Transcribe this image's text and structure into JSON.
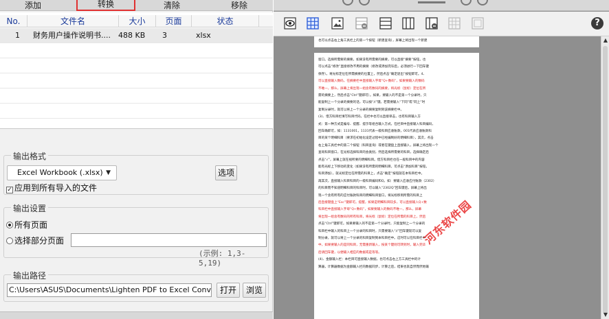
{
  "toolbar": {
    "add": "添加",
    "convert": "转换",
    "clear": "清除",
    "remove": "移除"
  },
  "table": {
    "headers": {
      "no": "No.",
      "filename": "文件名",
      "size": "大小",
      "pages": "页面",
      "status": "状态"
    },
    "rows": [
      {
        "no": "1",
        "filename": "财务用户操作说明书....",
        "size": "488 KB",
        "pages": "3",
        "status": "xlsx"
      }
    ]
  },
  "output_format": {
    "title": "输出格式",
    "selected": "Excel Workbook (.xlsx)",
    "options_button": "选项",
    "apply_all_label": "应用到所有导入的文件",
    "apply_all_checked": true
  },
  "output_settings": {
    "title": "输出设置",
    "all_pages": "所有页面",
    "select_pages": "选择部分页面",
    "page_range_value": "",
    "example": "(示例: 1,3-5,19)"
  },
  "output_path": {
    "title": "输出路径",
    "value": "C:\\Users\\ASUS\\Documents\\Lighten PDF to Excel Converter",
    "open_button": "打开",
    "browse_button": "浏览"
  },
  "viewer": {
    "help_label": "?",
    "watermark": "河东软件园",
    "page1_text": "也可以点击右上角工具栏上的第一个按钮（新建查询），屏幕上将出现一个新建",
    "page2_lines": [
      {
        "t": "窗口。选择所需要的摘要，如果没有所需要的摘要，可以直接“摘要”按钮，也",
        "red": false
      },
      {
        "t": "可以点击“修改”直接修改不用的摘要（修改或添加完毕后，必须进行一下回车键",
        "red": false
      },
      {
        "t": "保存）。将光标定位在所需摘要的位置上，然后点击“确定退出”按钮即可。4、",
        "red": false
      },
      {
        "t": "可以直接输入数码，在摘要栏中直接输入字母“Q+数码”，如果要输入的数码",
        "red": true
      },
      {
        "t": "不唯一，那么，屏幕上将出现一组含有数码的摘要，将光标（鼠标）定位在所",
        "red": true
      },
      {
        "t": "需的摘要上，然后点击“Ctrl”键即可）。如果，要输入的不是第一个分录时，只",
        "red": false
      },
      {
        "t": "能复制上一个分录的摘要的话，可以按“//”键。若需要输入“下同”或“同上”时",
        "red": false
      },
      {
        "t": "复制分录时，就可以将上一个分录的摘要复制到该摘要栏中。",
        "red": false
      },
      {
        "t": "(3)、借方科目栏填写科目代码，在栏中也可以直接单击，也有科目输入方",
        "red": false
      },
      {
        "t": "式：第一种方式是编号、提醒、提示等组合输入方式，在栏目中直接输入科目编码，",
        "red": false
      },
      {
        "t": "回车确即可，如：1131001，1131代表一级科目应收账款，001代表应收账款科",
        "red": false
      },
      {
        "t": "目的某个明细科目（要求在初始化设定过程中已经编制好的明细科目），其次，点击",
        "red": false
      },
      {
        "t": "右上角工具栏中的第二个按钮（科目查询）或者在键盘上直接输入，屏幕上将出现一个",
        "red": false
      },
      {
        "t": "查询科目窗口，在光标选择科目的会类别，然后选择所需要的科目，选择确定后",
        "red": false
      },
      {
        "t": "点击“√”，屏幕上就在视所要的明细科目。借方科目栏也在一般科目中的内容",
        "red": false
      },
      {
        "t": "能有光标上下移动的变化（如果没有所需的明细科目，可点击“添加科目”按钮，",
        "red": false
      },
      {
        "t": "科目添加），就光标定位在所需的科目上，点击“确定”按钮就在本科目栏中。",
        "red": false
      },
      {
        "t": "再其次，直接输入科目科目的一级科目编码和Q，如：要输入应收应付账款（2302）",
        "red": false
      },
      {
        "t": "的科目而不知道明细科目的科目时，可以输入“2302Q”回车键后，屏幕上将出",
        "red": false
      },
      {
        "t": "现一个含有所有的应付账款科目的明细科目窗口，将光标移到所需的科目上",
        "red": false
      },
      {
        "t": "后直接键盘上“Esc”键即可。提醒，如果是明细科目较多，可以直接输入Q+数",
        "red": true
      },
      {
        "t": "科目栏中直接输入字母“Q+数码”，如果要输入的数码不唯一，那么，屏幕",
        "red": true
      },
      {
        "t": "将出现一组含有数码的所有科目，将光标（鼠标）定位在所需的科目上，然后",
        "red": true
      },
      {
        "t": "点击“Ctrl”键即可。如果要输入的不是第一个分录时，只能复制上一个分录的",
        "red": false
      },
      {
        "t": "科目栏中输入的科目上一个分录的科目时，只需要输入“//”回车键就可以复",
        "red": false
      },
      {
        "t": "制分录，就可以将上一个分录的科目复制到本科目栏中。这时可以在科目栏中",
        "red": false
      },
      {
        "t": "中，如果要输入的是同科目，无需重新输入，按某个键则可转到时，输入完毕",
        "red": true
      },
      {
        "t": "后请回车键，以便输入相应的数据或是等等。",
        "red": true
      },
      {
        "t": "(4)、金额输入栏：本栏目可直接输入数据，也可点击右上方工具栏中的计",
        "red": false
      },
      {
        "t": "算器，计算器数据为金额输入栏的数据同步，计算之后，结果也就自然而然地输",
        "red": false
      }
    ]
  }
}
